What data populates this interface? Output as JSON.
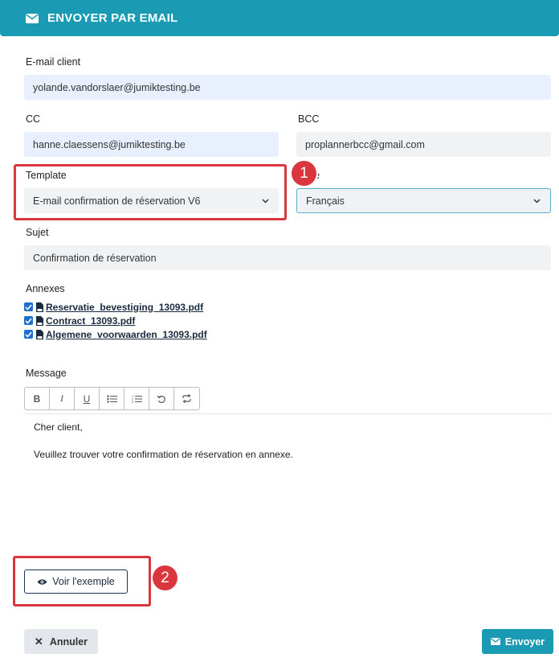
{
  "header": {
    "title": "ENVOYER PAR EMAIL",
    "icon": "envelope-icon"
  },
  "form": {
    "email_client": {
      "label": "E-mail client",
      "value": "yolande.vandorslaer@jumiktesting.be"
    },
    "cc": {
      "label": "CC",
      "value": "hanne.claessens@jumiktesting.be"
    },
    "bcc": {
      "label": "BCC",
      "value": "proplannerbcc@gmail.com"
    },
    "template": {
      "label": "Template",
      "value": "E-mail confirmation de réservation V6"
    },
    "langue": {
      "label_visible": "ue",
      "value": "Français"
    },
    "sujet": {
      "label": "Sujet",
      "value": "Confirmation de réservation"
    }
  },
  "annexes": {
    "label": "Annexes",
    "files": [
      {
        "name": "Reservatie_bevestiging_13093.pdf",
        "checked": true
      },
      {
        "name": "Contract_13093.pdf",
        "checked": true
      },
      {
        "name": "Algemene_voorwaarden_13093.pdf",
        "checked": true
      }
    ]
  },
  "message": {
    "label": "Message",
    "toolbar": {
      "bold": "B",
      "italic": "I",
      "underline": "U"
    },
    "line1": "Cher client,",
    "line2": "Veuillez trouver votre confirmation de réservation en annexe."
  },
  "buttons": {
    "preview": "Voir l'exemple",
    "cancel": "Annuler",
    "send": "Envoyer"
  },
  "annotations": {
    "badge1": "1",
    "badge2": "2"
  },
  "colors": {
    "accent": "#1a9bb3",
    "highlight": "#d9363e",
    "checkbox": "#1f6fd1"
  }
}
